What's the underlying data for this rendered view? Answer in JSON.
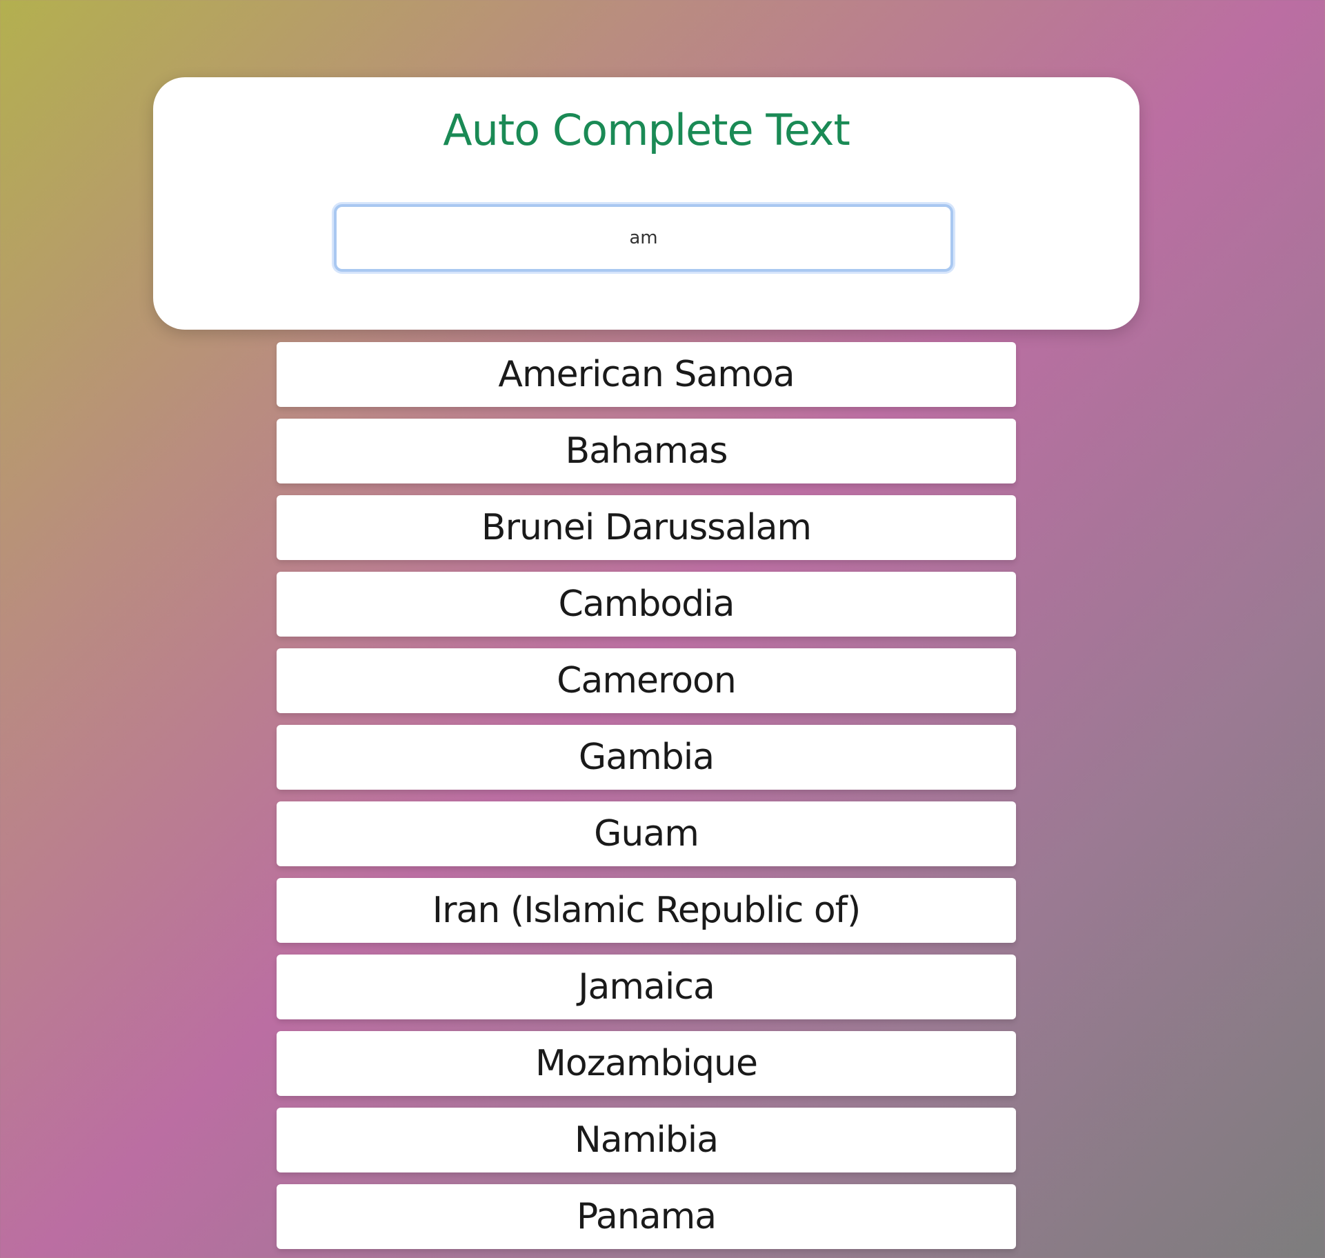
{
  "header": {
    "title": "Auto Complete Text"
  },
  "search": {
    "value": "am"
  },
  "suggestions": [
    "American Samoa",
    "Bahamas",
    "Brunei Darussalam",
    "Cambodia",
    "Cameroon",
    "Gambia",
    "Guam",
    "Iran (Islamic Republic of)",
    "Jamaica",
    "Mozambique",
    "Namibia",
    "Panama"
  ],
  "colors": {
    "title": "#1a8a55",
    "input_border": "#a9c8f1"
  }
}
